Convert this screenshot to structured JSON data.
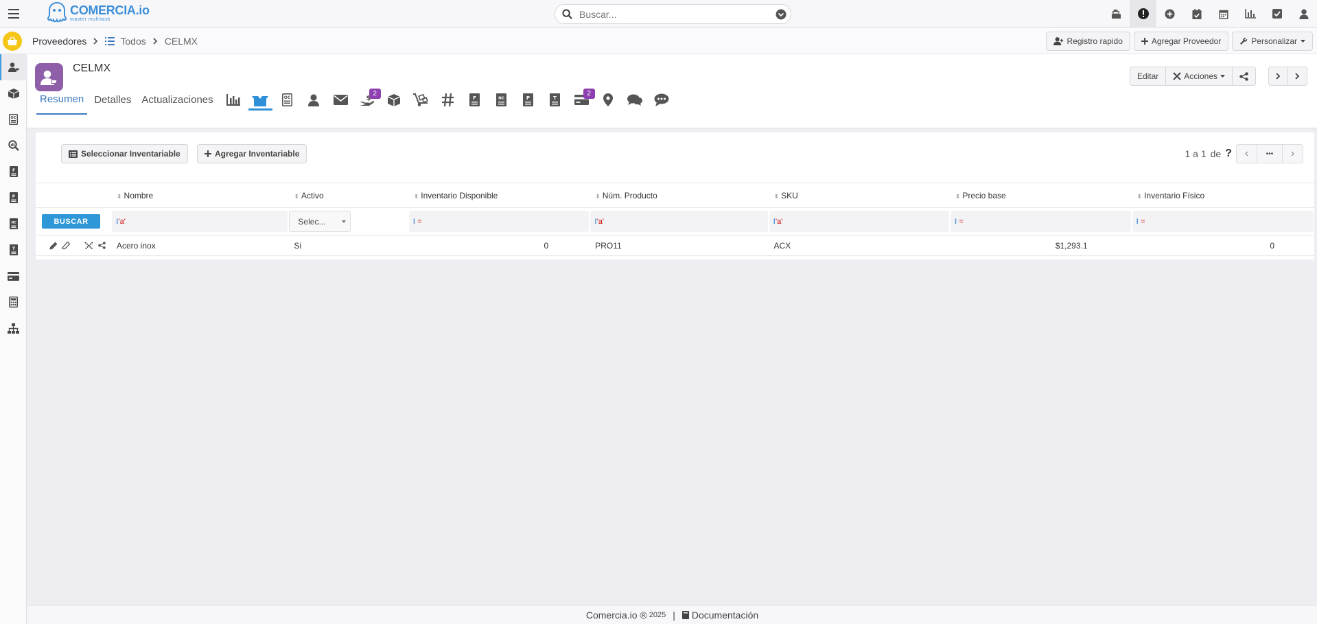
{
  "app": {
    "logo_title": "COMERCIA.io",
    "logo_subtitle": "master multitask"
  },
  "search": {
    "placeholder": "Buscar..."
  },
  "topbar_icons": [
    "cash-register-icon",
    "alert-icon",
    "plus-circle-icon",
    "calendar-check-icon",
    "calendar-icon",
    "chart-bar-icon",
    "check-square-icon",
    "user-icon"
  ],
  "breadcrumb": {
    "root": "Proveedores",
    "list": "Todos",
    "current": "CELMX"
  },
  "header_actions": {
    "quick_register": "Registro rapido",
    "add_supplier": "Agregar Proveedor",
    "customize": "Personalizar"
  },
  "sidebar": [
    "supplier-user-icon",
    "box-icon",
    "purchase-order-icon",
    "search-chart-icon",
    "invoice-f-icon",
    "doc-p-icon",
    "credit-note-icon",
    "doc-t-icon",
    "card-icon",
    "calculator-icon",
    "org-chart-icon"
  ],
  "record": {
    "title": "CELMX",
    "edit": "Editar",
    "actions": "Acciones",
    "tabs": [
      "Resumen",
      "Detalles",
      "Actualizaciones"
    ],
    "tab_icons": [
      {
        "name": "chart-icon",
        "badge": ""
      },
      {
        "name": "inventory-box-icon",
        "badge": ""
      },
      {
        "name": "purchase-order-icon",
        "badge": ""
      },
      {
        "name": "contact-icon",
        "badge": ""
      },
      {
        "name": "email-icon",
        "badge": ""
      },
      {
        "name": "payments-icon",
        "badge": "2"
      },
      {
        "name": "cube-icon",
        "badge": ""
      },
      {
        "name": "dolly-icon",
        "badge": ""
      },
      {
        "name": "hashtag-icon",
        "badge": ""
      },
      {
        "name": "invoice-f-icon",
        "badge": ""
      },
      {
        "name": "credit-note-icon",
        "badge": ""
      },
      {
        "name": "doc-p-icon",
        "badge": ""
      },
      {
        "name": "doc-t-icon",
        "badge": ""
      },
      {
        "name": "card-icon",
        "badge": "2"
      },
      {
        "name": "location-icon",
        "badge": ""
      },
      {
        "name": "comments-icon",
        "badge": ""
      },
      {
        "name": "chat-icon",
        "badge": ""
      }
    ]
  },
  "panel": {
    "select_inventory": "Seleccionar Inventariable",
    "add_inventory": "Agregar Inventariable",
    "pagination": "1 a 1",
    "pagination_of": "de",
    "pagination_unknown": "?",
    "more": "•••"
  },
  "table": {
    "headers": [
      "Nombre",
      "Activo",
      "Inventario Disponible",
      "Núm. Producto",
      "SKU",
      "Precio base",
      "Inventario Físico"
    ],
    "search_button": "BUSCAR",
    "filters": {
      "nombre": "'a'",
      "activo": "Selec...",
      "inv_disp": "=",
      "num_prod": "'a'",
      "sku": "'a'",
      "precio": "=",
      "inv_fisico": "="
    },
    "rows": [
      {
        "nombre": "Acero inox",
        "activo": "Si",
        "inv_disp": "0",
        "num_prod": "PRO11",
        "sku": "ACX",
        "precio": "$1,293.1",
        "inv_fisico": "0"
      }
    ]
  },
  "footer": {
    "brand": "Comercia.io ®",
    "year": "2025",
    "docs": "Documentación"
  }
}
